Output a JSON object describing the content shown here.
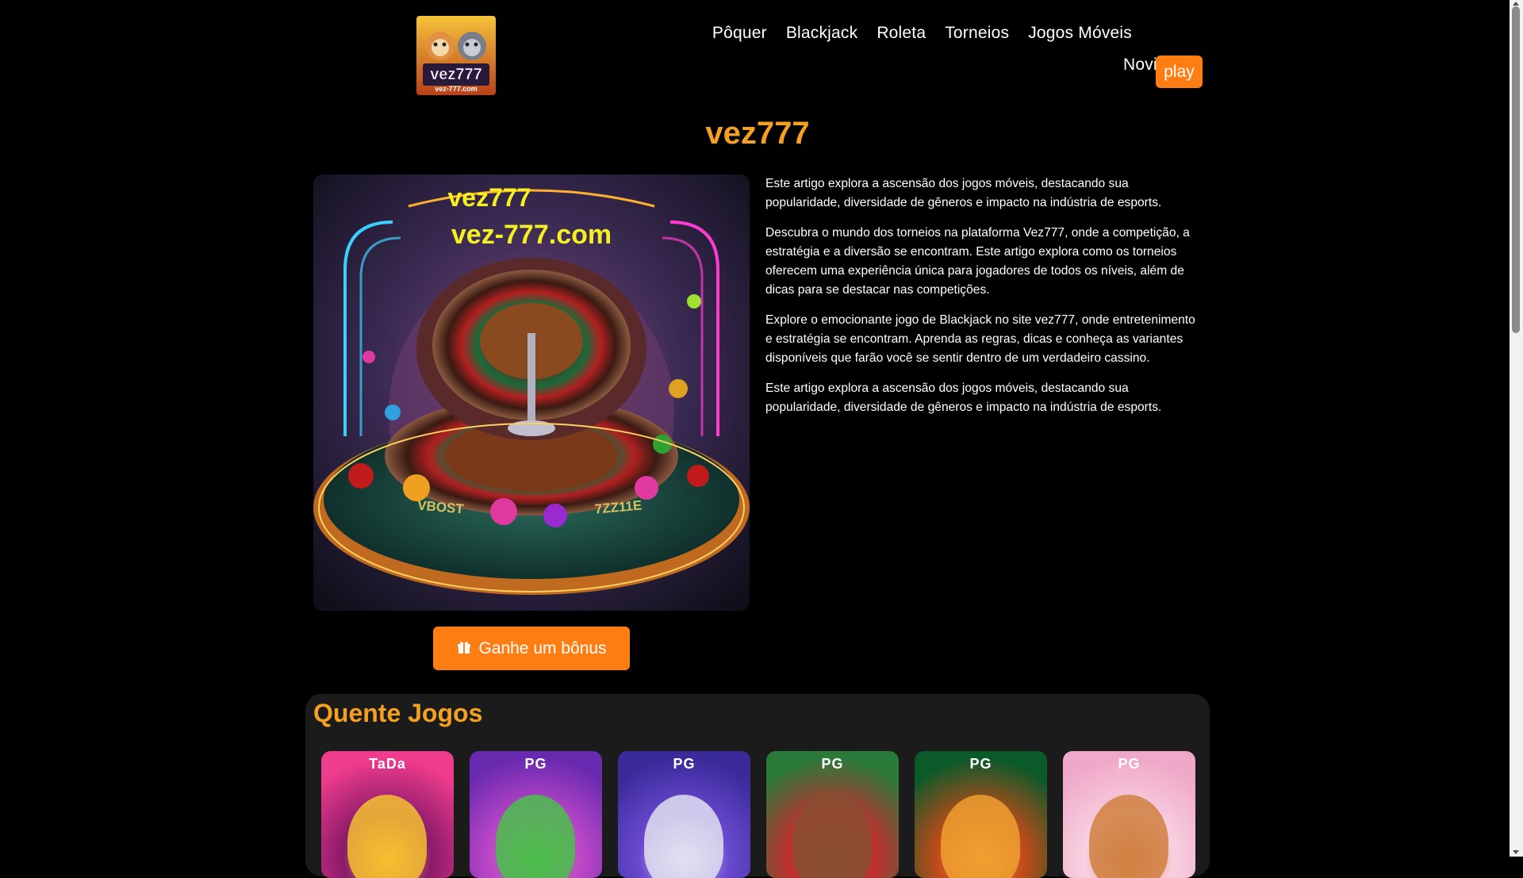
{
  "header": {
    "logo_text": "vez777",
    "logo_sub": "vez-777.com",
    "nav": [
      "Pôquer",
      "Blackjack",
      "Roleta",
      "Torneios",
      "Jogos Móveis"
    ],
    "nav2": [
      "Novidades"
    ],
    "play_label": "play"
  },
  "page_title": "vez777",
  "hero": {
    "line1": "vez777",
    "line2": "vez-777.com",
    "table_text1": "VBOST",
    "table_text2": "7ZZ11E"
  },
  "bonus_button": "Ganhe um bônus",
  "articles": [
    "Este artigo explora a ascensão dos jogos móveis, destacando sua popularidade, diversidade de gêneros e impacto na indústria de esports.",
    "Descubra o mundo dos torneios na plataforma Vez777, onde a competição, a estratégia e a diversão se encontram. Este artigo explora como os torneios oferecem uma experiência única para jogadores de todos os níveis, além de dicas para se destacar nas competições.",
    "Explore o emocionante jogo de Blackjack no site vez777, onde entretenimento e estratégia se encontram. Aprenda as regras, dicas e conheça as variantes disponíveis que farão você se sentir dentro de um verdadeiro cassino.",
    "Este artigo explora a ascensão dos jogos móveis, destacando sua popularidade, diversidade de gêneros e impacto na indústria de esports."
  ],
  "hot_games": {
    "title": "Quente Jogos",
    "games": [
      {
        "brand": "TaDa",
        "colors": [
          "#f03c8c",
          "#8a1a6a",
          "#f5c030"
        ]
      },
      {
        "brand": "PG",
        "colors": [
          "#6a2ab0",
          "#c048c8",
          "#4bc04b"
        ]
      },
      {
        "brand": "PG",
        "colors": [
          "#3a2a9a",
          "#6a4ad0",
          "#e0e0f0"
        ]
      },
      {
        "brand": "PG",
        "colors": [
          "#2a7a3a",
          "#c03030",
          "#8a5030"
        ]
      },
      {
        "brand": "PG",
        "colors": [
          "#0a5a2a",
          "#c04a1a",
          "#f0a030"
        ]
      },
      {
        "brand": "PG",
        "colors": [
          "#f0a8c8",
          "#f8d0e0",
          "#d08040"
        ]
      }
    ]
  }
}
